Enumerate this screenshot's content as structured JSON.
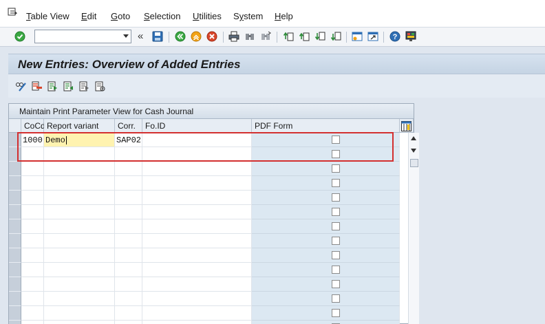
{
  "menu": {
    "items": [
      {
        "label": "Table View",
        "underline": "T"
      },
      {
        "label": "Edit",
        "underline": "E"
      },
      {
        "label": "Goto",
        "underline": "G"
      },
      {
        "label": "Selection",
        "underline": "S"
      },
      {
        "label": "Utilities",
        "underline": "U"
      },
      {
        "label": "System",
        "underline": "y"
      },
      {
        "label": "Help",
        "underline": "H"
      }
    ]
  },
  "toolbar": {
    "command_value": "",
    "icons": [
      "enter-icon",
      "save-icon",
      "back-icon",
      "exit-icon",
      "cancel-icon",
      "print-icon",
      "find-icon",
      "find-next-icon",
      "first-page-icon",
      "previous-page-icon",
      "next-page-icon",
      "last-page-icon",
      "create-session-icon",
      "shortcut-icon",
      "help-icon",
      "layout-menu-icon"
    ]
  },
  "title": "New Entries: Overview of Added Entries",
  "table": {
    "title": "Maintain Print Parameter View for Cash Journal",
    "columns": [
      "CoCd",
      "Report variant",
      "Corr.",
      "Fo.ID",
      "PDF Form"
    ],
    "rows": [
      {
        "cocd": "1000",
        "report_variant": "Demo",
        "corr": "SAP02",
        "foid": "",
        "pdf_form": false
      },
      {
        "cocd": "",
        "report_variant": "",
        "corr": "",
        "foid": "",
        "pdf_form": false
      },
      {
        "cocd": "",
        "report_variant": "",
        "corr": "",
        "foid": "",
        "pdf_form": false
      },
      {
        "cocd": "",
        "report_variant": "",
        "corr": "",
        "foid": "",
        "pdf_form": false
      },
      {
        "cocd": "",
        "report_variant": "",
        "corr": "",
        "foid": "",
        "pdf_form": false
      },
      {
        "cocd": "",
        "report_variant": "",
        "corr": "",
        "foid": "",
        "pdf_form": false
      },
      {
        "cocd": "",
        "report_variant": "",
        "corr": "",
        "foid": "",
        "pdf_form": false
      },
      {
        "cocd": "",
        "report_variant": "",
        "corr": "",
        "foid": "",
        "pdf_form": false
      },
      {
        "cocd": "",
        "report_variant": "",
        "corr": "",
        "foid": "",
        "pdf_form": false
      },
      {
        "cocd": "",
        "report_variant": "",
        "corr": "",
        "foid": "",
        "pdf_form": false
      },
      {
        "cocd": "",
        "report_variant": "",
        "corr": "",
        "foid": "",
        "pdf_form": false
      },
      {
        "cocd": "",
        "report_variant": "",
        "corr": "",
        "foid": "",
        "pdf_form": false
      },
      {
        "cocd": "",
        "report_variant": "",
        "corr": "",
        "foid": "",
        "pdf_form": false
      },
      {
        "cocd": "",
        "report_variant": "",
        "corr": "",
        "foid": "",
        "pdf_form": false
      }
    ]
  },
  "colors": {
    "highlight": "#d32f2f",
    "active_cell": "#fff3b0",
    "pdf_column": "#dce8f2"
  }
}
